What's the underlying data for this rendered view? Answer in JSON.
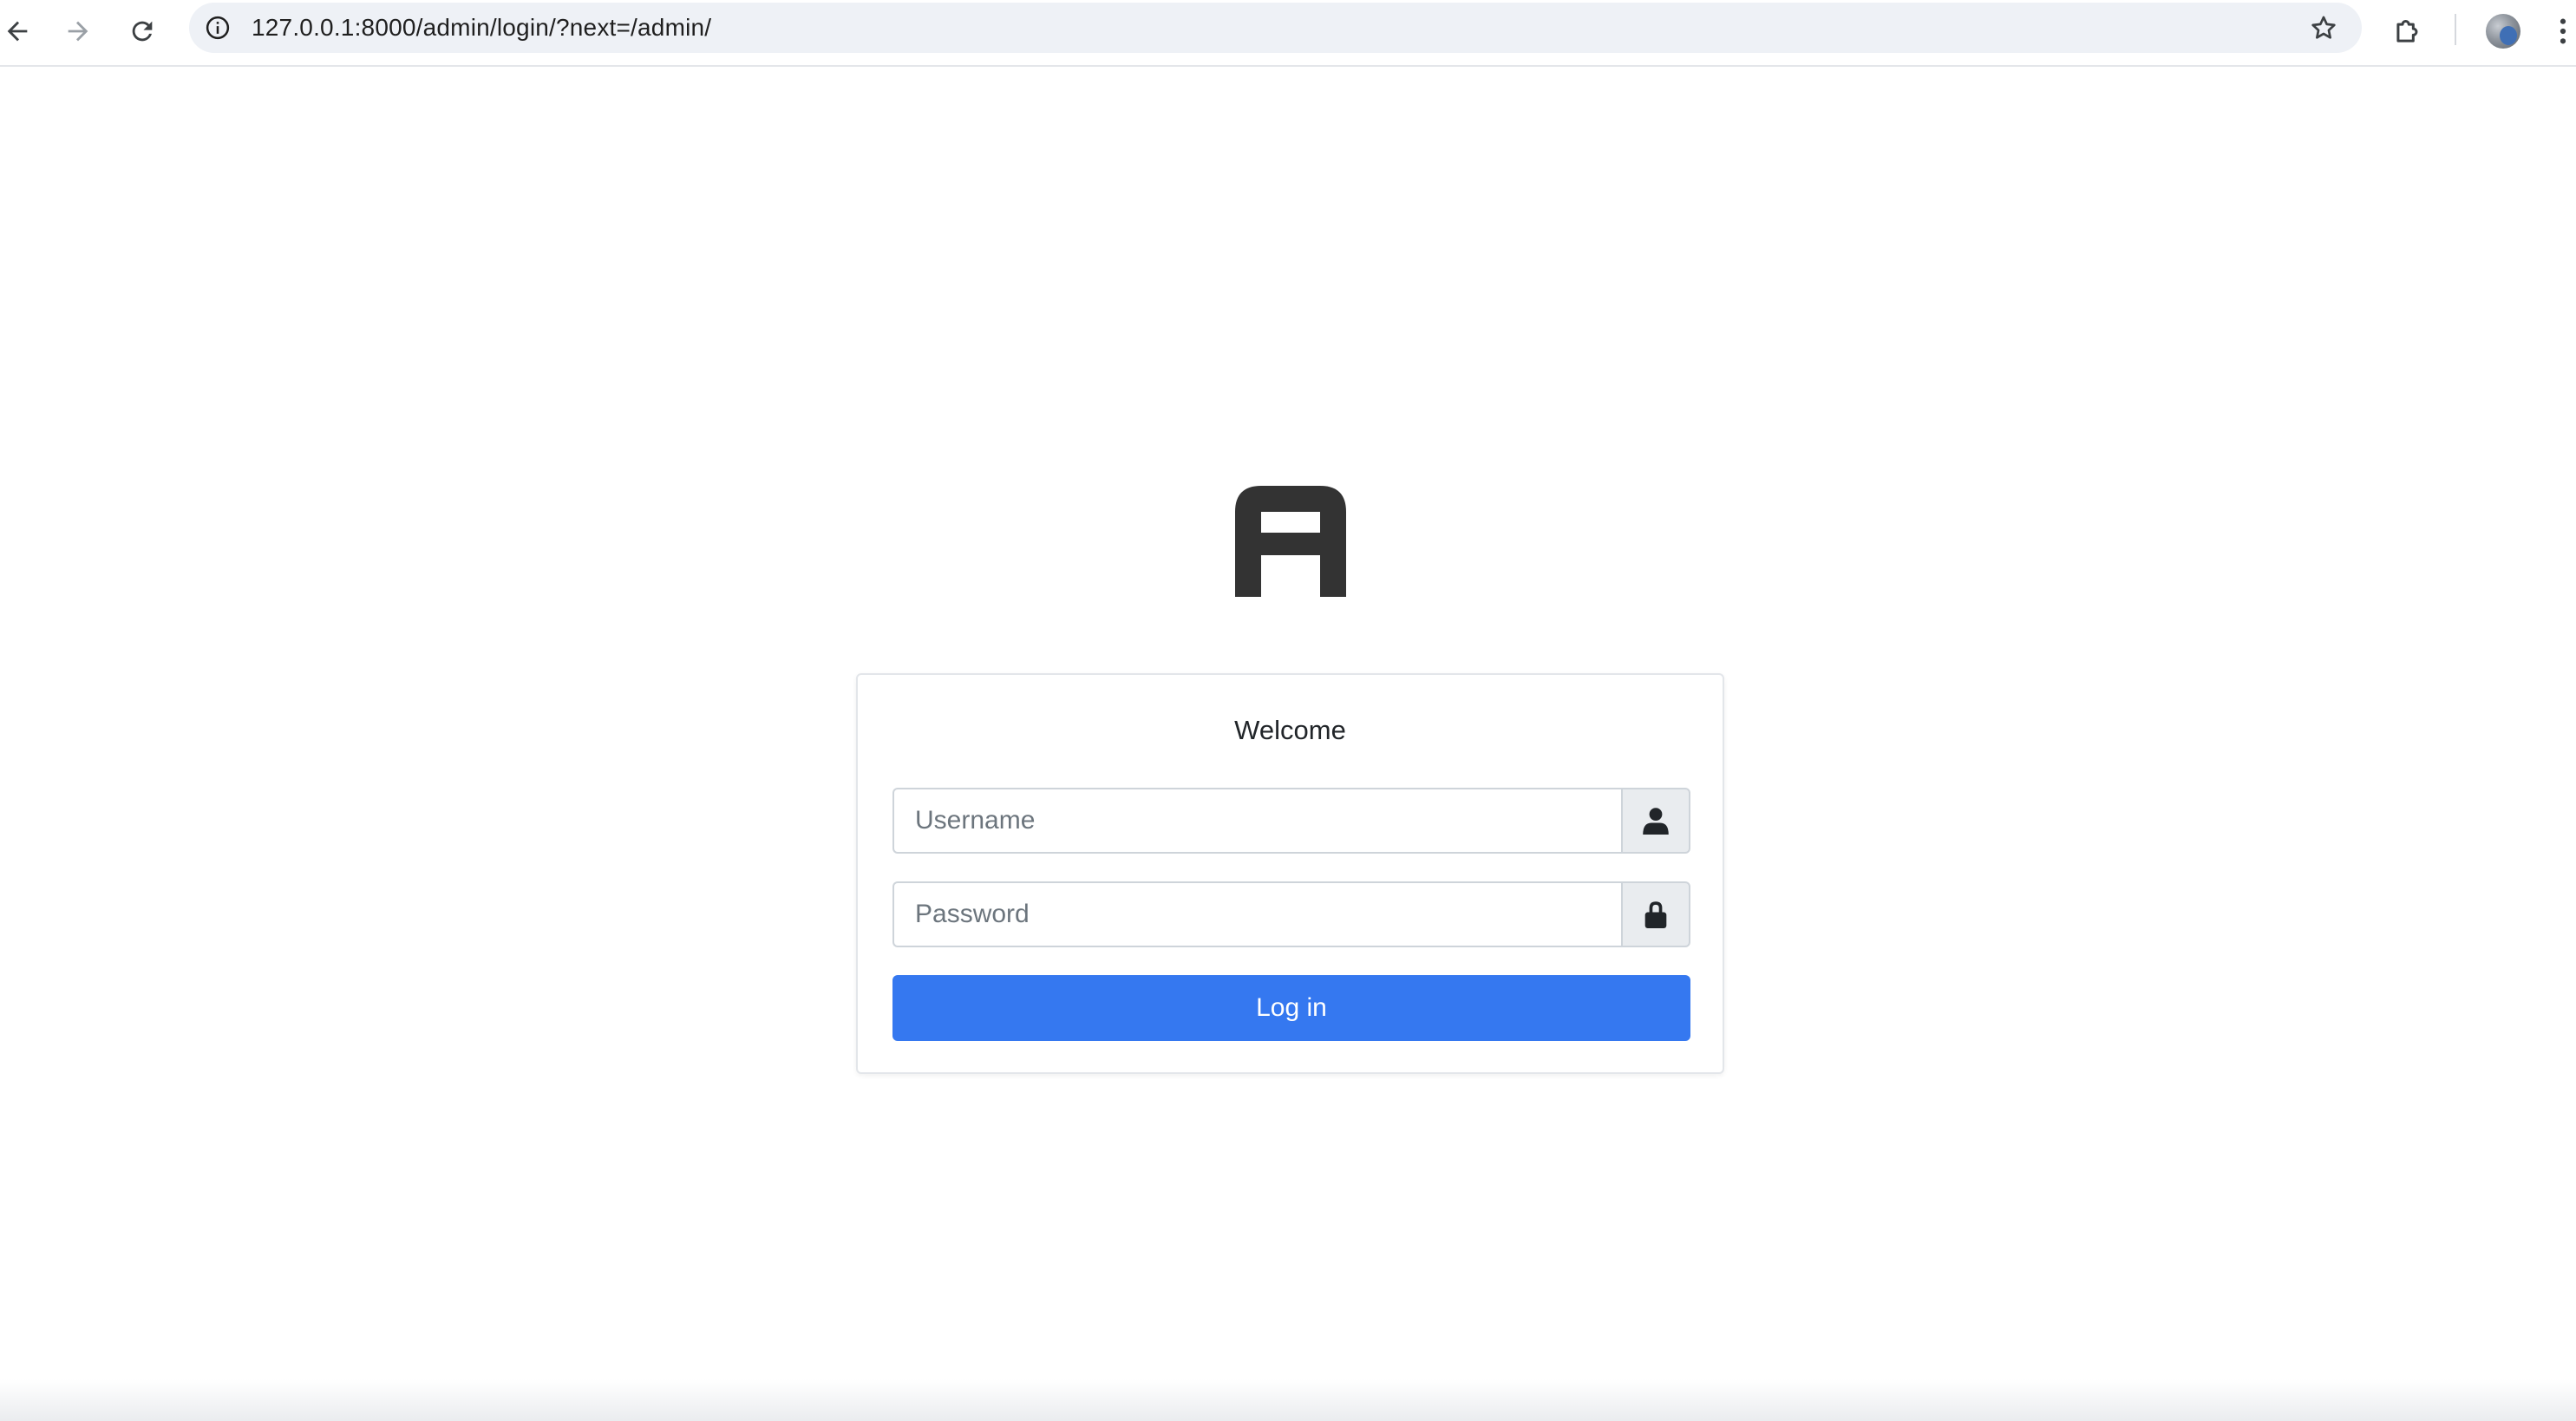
{
  "browser": {
    "url": "127.0.0.1:8000/admin/login/?next=/admin/",
    "icons": {
      "back": "arrow-left-icon",
      "forward": "arrow-right-icon",
      "reload": "reload-icon",
      "site_info": "info-circle-icon",
      "bookmark": "star-outline-icon",
      "extensions": "puzzle-icon",
      "profile": "avatar",
      "menu": "kebab-menu-icon"
    }
  },
  "login": {
    "title": "Welcome",
    "username_placeholder": "Username",
    "password_placeholder": "Password",
    "submit_label": "Log in",
    "icons": {
      "logo": "letter-a-logo",
      "username": "user-icon",
      "password": "lock-icon"
    }
  },
  "colors": {
    "primary_button": "#3578f0",
    "logo": "#333333",
    "addon_background": "#e9ecef",
    "omnibox_background": "#eef1f6"
  }
}
